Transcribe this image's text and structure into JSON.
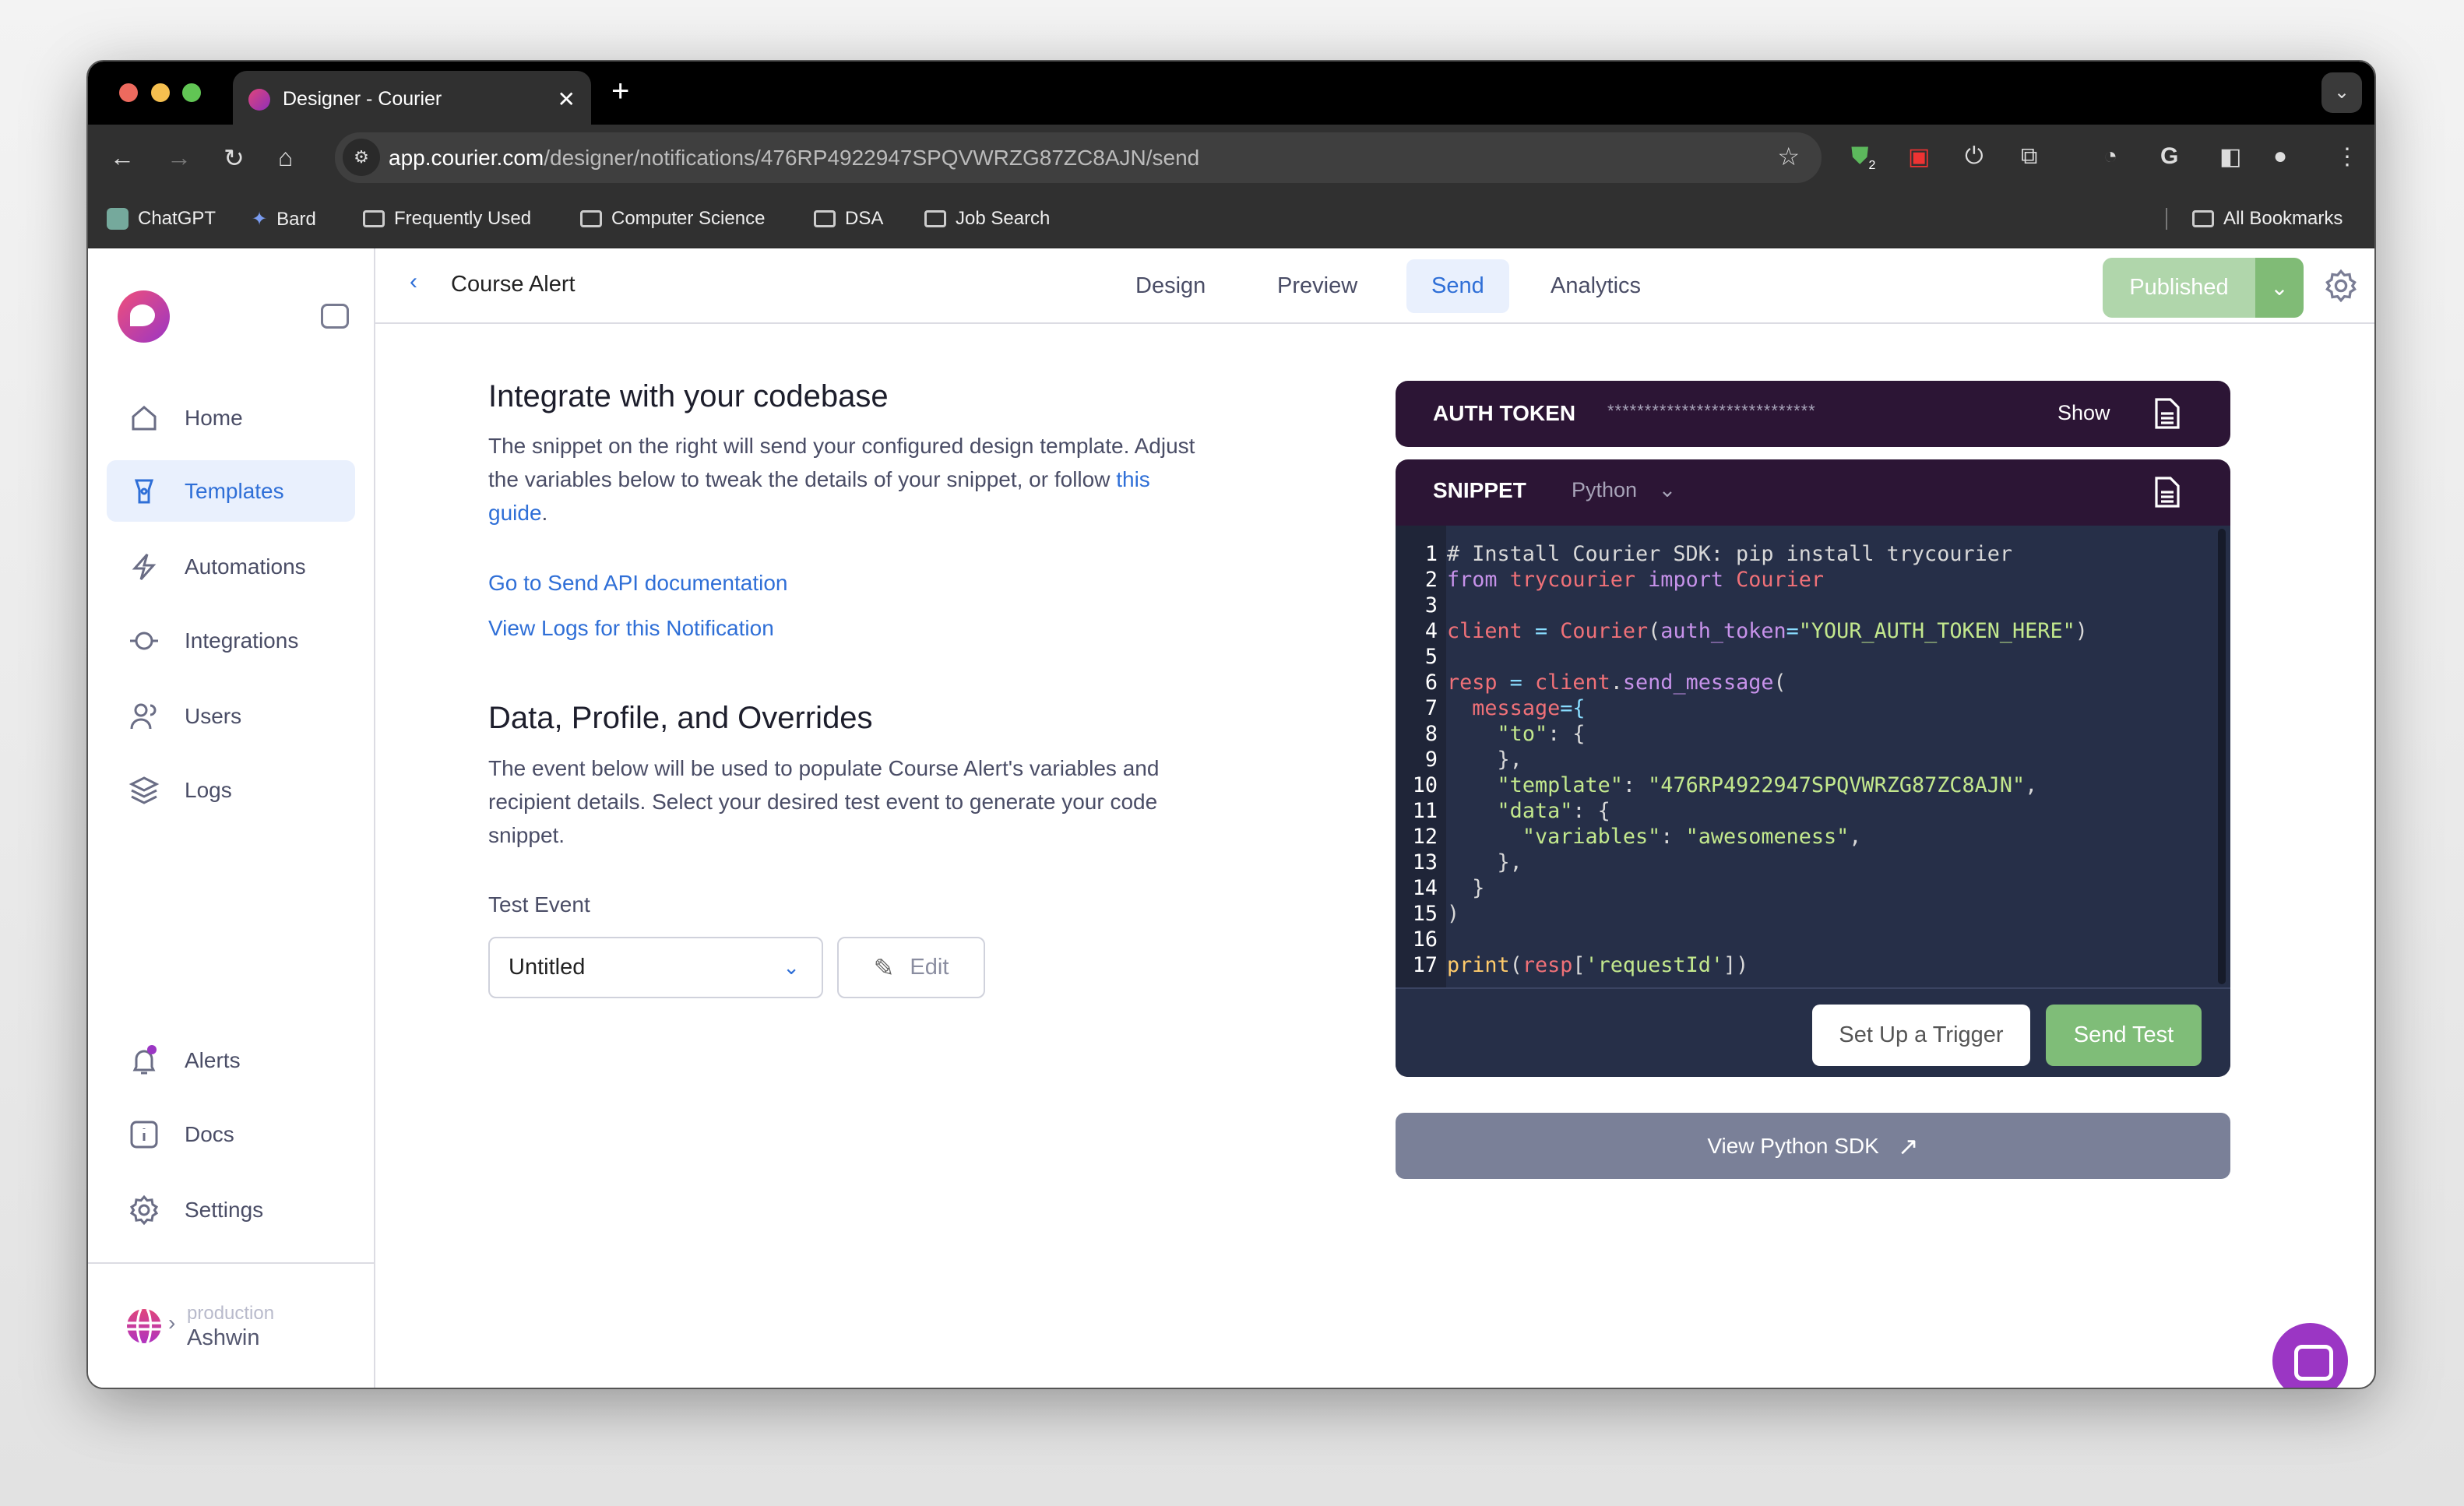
{
  "browser": {
    "tab_title": "Designer - Courier",
    "url_host": "app.courier.com",
    "url_path": "/designer/notifications/476RP4922947SPQVWRZG87ZC8AJN/send",
    "extension_badge": "2",
    "bookmarks": [
      "ChatGPT",
      "Bard",
      "Frequently Used",
      "Computer Science",
      "DSA",
      "Job Search"
    ],
    "all_bookmarks": "All Bookmarks"
  },
  "sidebar": {
    "items": [
      {
        "label": "Home",
        "icon": "home-icon"
      },
      {
        "label": "Templates",
        "icon": "templates-icon",
        "active": true
      },
      {
        "label": "Automations",
        "icon": "lightning-icon"
      },
      {
        "label": "Integrations",
        "icon": "integrations-icon"
      },
      {
        "label": "Users",
        "icon": "users-icon"
      },
      {
        "label": "Logs",
        "icon": "layers-icon"
      }
    ],
    "bottom_items": [
      {
        "label": "Alerts",
        "icon": "bell-icon"
      },
      {
        "label": "Docs",
        "icon": "info-icon"
      },
      {
        "label": "Settings",
        "icon": "gear-icon"
      }
    ],
    "environment": "production",
    "workspace": "Ashwin"
  },
  "header": {
    "title": "Course Alert",
    "tabs": [
      "Design",
      "Preview",
      "Send",
      "Analytics"
    ],
    "active_tab": "Send",
    "publish_label": "Published"
  },
  "main": {
    "integrate_title": "Integrate with your codebase",
    "integrate_text": "The snippet on the right will send your configured design template. Adjust the variables below to tweak the details of your snippet, or follow ",
    "guide_link": "this guide",
    "period": ".",
    "api_docs_link": "Go to Send API documentation",
    "logs_link": "View Logs for this Notification",
    "data_title": "Data, Profile, and Overrides",
    "data_text": "The event below will be used to populate Course Alert's variables and recipient details. Select your desired test event to generate your code snippet.",
    "test_event_label": "Test Event",
    "test_event_value": "Untitled",
    "edit_label": "Edit"
  },
  "auth": {
    "label": "AUTH TOKEN",
    "masked": "****************************",
    "show_label": "Show"
  },
  "snippet": {
    "label": "SNIPPET",
    "language": "Python",
    "lines": [
      [
        [
          "# Install Courier SDK: pip install trycourier",
          "cm"
        ]
      ],
      [
        [
          "from",
          "kw"
        ],
        [
          " ",
          "p"
        ],
        [
          "trycourier",
          "id"
        ],
        [
          " ",
          "p"
        ],
        [
          "import",
          "kw"
        ],
        [
          " ",
          "p"
        ],
        [
          "Courier",
          "id"
        ]
      ],
      [],
      [
        [
          "client",
          "id"
        ],
        [
          " = ",
          "op"
        ],
        [
          "Courier",
          "id"
        ],
        [
          "(",
          "p"
        ],
        [
          "auth_token",
          "fn"
        ],
        [
          "=",
          "op"
        ],
        [
          "\"YOUR_AUTH_TOKEN_HERE\"",
          "str"
        ],
        [
          ")",
          "p"
        ]
      ],
      [],
      [
        [
          "resp",
          "id"
        ],
        [
          " = ",
          "op"
        ],
        [
          "client",
          "id"
        ],
        [
          ".",
          "p"
        ],
        [
          "send_message",
          "fn"
        ],
        [
          "(",
          "p"
        ]
      ],
      [
        [
          "  ",
          "p"
        ],
        [
          "message",
          "id"
        ],
        [
          "={",
          "op"
        ]
      ],
      [
        [
          "    ",
          "p"
        ],
        [
          "\"to\"",
          "str"
        ],
        [
          ": {",
          "p"
        ]
      ],
      [
        [
          "    },",
          "p"
        ]
      ],
      [
        [
          "    ",
          "p"
        ],
        [
          "\"template\"",
          "str"
        ],
        [
          ": ",
          "p"
        ],
        [
          "\"476RP4922947SPQVWRZG87ZC8AJN\"",
          "str"
        ],
        [
          ",",
          "p"
        ]
      ],
      [
        [
          "    ",
          "p"
        ],
        [
          "\"data\"",
          "str"
        ],
        [
          ": {",
          "p"
        ]
      ],
      [
        [
          "      ",
          "p"
        ],
        [
          "\"variables\"",
          "str"
        ],
        [
          ": ",
          "p"
        ],
        [
          "\"awesomeness\"",
          "str"
        ],
        [
          ",",
          "p"
        ]
      ],
      [
        [
          "    },",
          "p"
        ]
      ],
      [
        [
          "  }",
          "p"
        ]
      ],
      [
        [
          ")",
          "p"
        ]
      ],
      [],
      [
        [
          "print",
          "pr"
        ],
        [
          "(",
          "p"
        ],
        [
          "resp",
          "id"
        ],
        [
          "[",
          "p"
        ],
        [
          "'requestId'",
          "str"
        ],
        [
          "])",
          "p"
        ]
      ]
    ],
    "setup_trigger_label": "Set Up a Trigger",
    "send_test_label": "Send Test"
  },
  "sdk_link": "View Python SDK",
  "colors": {
    "accent": "#2f6fd7",
    "published": "#b0d6ab",
    "card": "#2c1535",
    "code_bg": "#262f48",
    "send_test": "#7fbd78"
  }
}
